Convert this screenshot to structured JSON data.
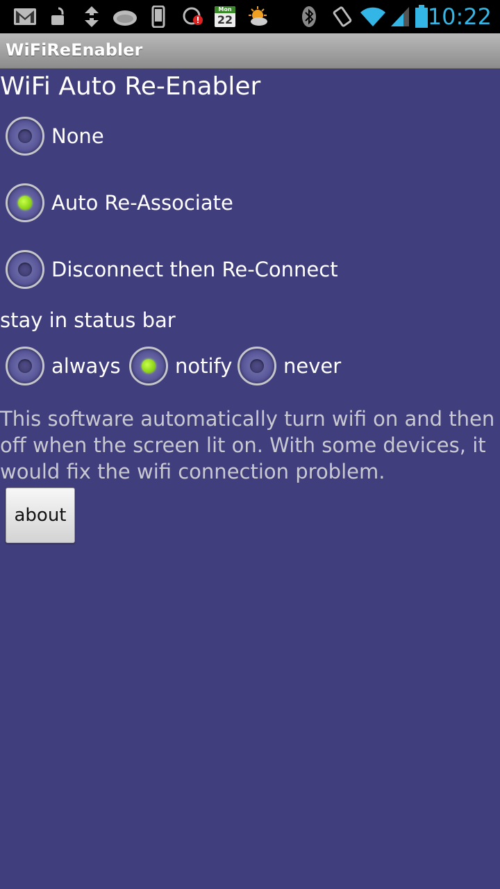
{
  "status_bar": {
    "time": "10:22",
    "calendar_day": "Mon",
    "calendar_date": "22",
    "icons": [
      "gmail-icon",
      "unlock-icon",
      "usb-debug-icon",
      "hedgehog-app-icon",
      "phone-icon",
      "alert-icon",
      "calendar-icon",
      "weather-icon",
      "bluetooth-icon",
      "rotate-icon",
      "wifi-icon",
      "signal-icon",
      "battery-icon"
    ]
  },
  "app_title": "WiFiReEnabler",
  "heading": "WiFi Auto Re-Enabler",
  "mode_options": [
    {
      "label": "None",
      "checked": false
    },
    {
      "label": "Auto Re-Associate",
      "checked": true
    },
    {
      "label": "Disconnect then Re-Connect",
      "checked": false
    }
  ],
  "status_bar_label": "stay in status bar",
  "status_options": [
    {
      "label": "always",
      "checked": false
    },
    {
      "label": "notify",
      "checked": true
    },
    {
      "label": "never",
      "checked": false
    }
  ],
  "description": "This software automatically turn wifi on and then off when the screen lit on.  With some devices, it would fix the wifi connection problem.",
  "about_button": "about",
  "colors": {
    "background": "#413e7d",
    "accent_time": "#33b5e5",
    "radio_checked": "#8fd51a"
  }
}
